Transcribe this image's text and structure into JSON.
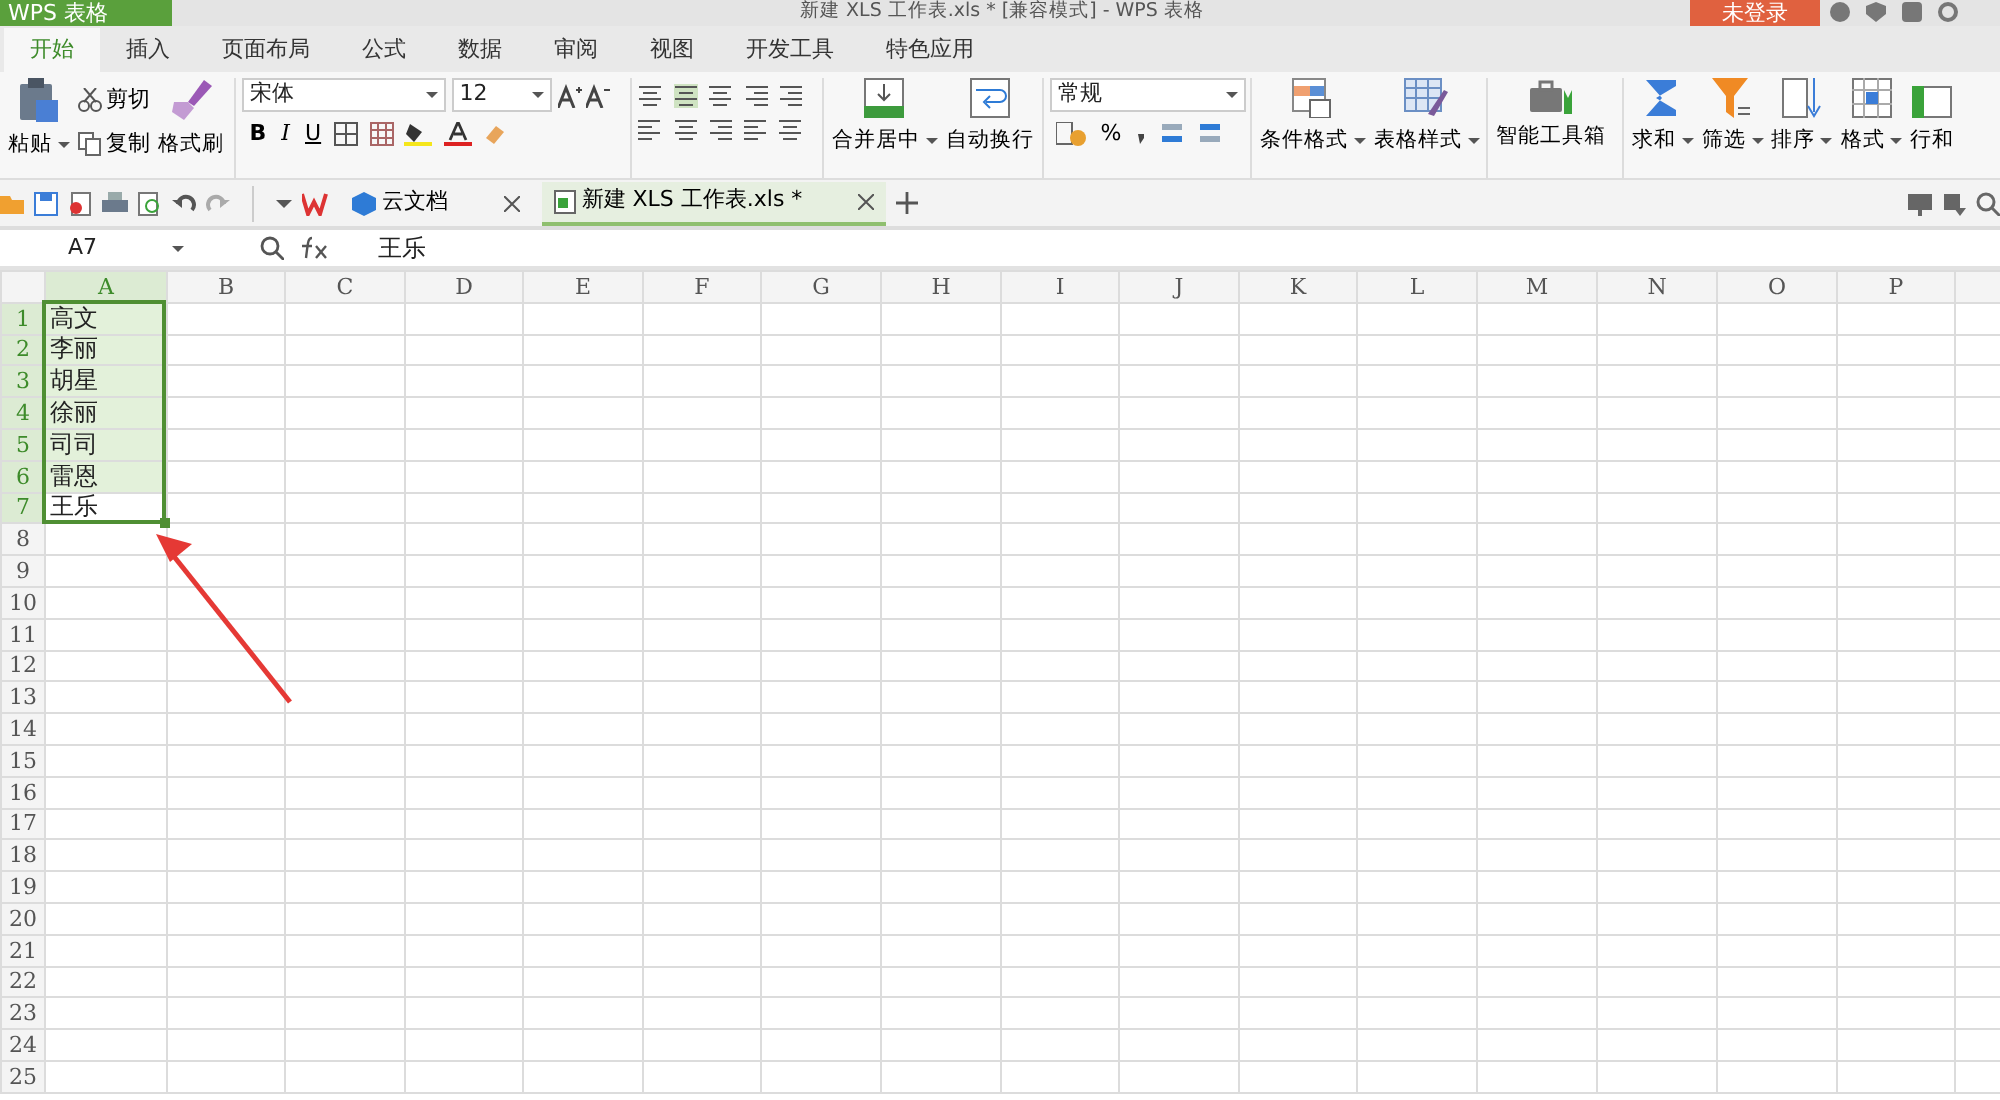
{
  "title_bar": {
    "app_menu": "WPS 表格",
    "title": "新建 XLS 工作表.xls * [兼容模式] - WPS 表格",
    "login": "未登录"
  },
  "ribbon_tabs": [
    {
      "label": "开始",
      "selected": true
    },
    {
      "label": "插入",
      "selected": false
    },
    {
      "label": "页面布局",
      "selected": false
    },
    {
      "label": "公式",
      "selected": false
    },
    {
      "label": "数据",
      "selected": false
    },
    {
      "label": "审阅",
      "selected": false
    },
    {
      "label": "视图",
      "selected": false
    },
    {
      "label": "开发工具",
      "selected": false
    },
    {
      "label": "特色应用",
      "selected": false
    }
  ],
  "ribbon": {
    "paste": "粘贴",
    "cut": "剪切",
    "copy": "复制",
    "format_painter": "格式刷",
    "font_name": "宋体",
    "font_size": "12",
    "bold": "B",
    "italic": "I",
    "underline": "U",
    "merge": "合并居中",
    "wrap": "自动换行",
    "number_format": "常规",
    "percent": "%",
    "conditional_format": "条件格式",
    "table_style": "表格样式",
    "toolbox": "智能工具箱",
    "sum": "求和",
    "filter": "筛选",
    "sort": "排序",
    "format": "格式",
    "rows_columns": "行和"
  },
  "doc_tabs": [
    {
      "label": "云文档",
      "selected": false
    },
    {
      "label": "新建 XLS 工作表.xls *",
      "selected": true
    }
  ],
  "formula_bar": {
    "cell_ref": "A7",
    "formula": "王乐"
  },
  "sheet": {
    "columns": [
      "A",
      "B",
      "C",
      "D",
      "E",
      "F",
      "G",
      "H",
      "I",
      "J",
      "K",
      "L",
      "M",
      "N",
      "O",
      "P"
    ],
    "rows": [
      {
        "number": "1",
        "a": "高文",
        "selected": true,
        "active": false
      },
      {
        "number": "2",
        "a": "李丽",
        "selected": true,
        "active": false
      },
      {
        "number": "3",
        "a": "胡星",
        "selected": true,
        "active": false
      },
      {
        "number": "4",
        "a": "徐丽",
        "selected": true,
        "active": false
      },
      {
        "number": "5",
        "a": "司司",
        "selected": true,
        "active": false
      },
      {
        "number": "6",
        "a": "雷恩",
        "selected": true,
        "active": false
      },
      {
        "number": "7",
        "a": "王乐",
        "selected": true,
        "active": true
      },
      {
        "number": "8",
        "selected": false
      },
      {
        "number": "9",
        "selected": false
      },
      {
        "number": "10",
        "selected": false
      },
      {
        "number": "11",
        "selected": false
      },
      {
        "number": "12",
        "selected": false
      },
      {
        "number": "13",
        "selected": false
      },
      {
        "number": "14",
        "selected": false
      },
      {
        "number": "15",
        "selected": false
      },
      {
        "number": "16",
        "selected": false
      },
      {
        "number": "17",
        "selected": false
      },
      {
        "number": "18",
        "selected": false
      },
      {
        "number": "19",
        "selected": false
      },
      {
        "number": "20",
        "selected": false
      },
      {
        "number": "21",
        "selected": false
      },
      {
        "number": "22",
        "selected": false
      },
      {
        "number": "23",
        "selected": false
      },
      {
        "number": "24",
        "selected": false
      },
      {
        "number": "25",
        "selected": false
      }
    ]
  }
}
